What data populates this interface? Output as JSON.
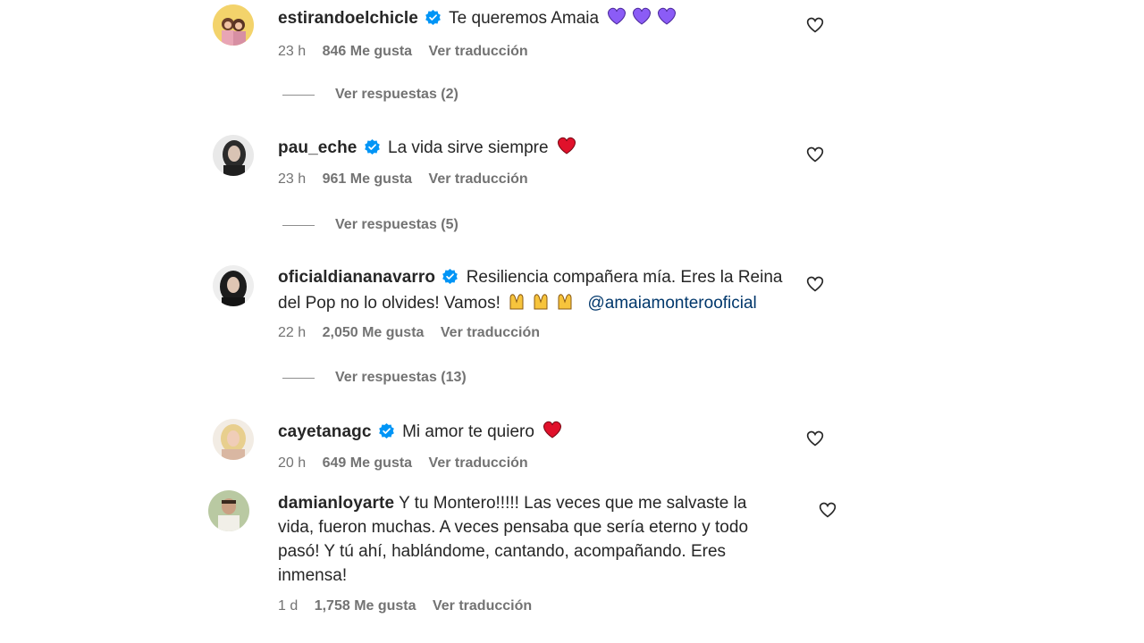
{
  "comments": [
    {
      "username": "estirandoelchicle",
      "verified": true,
      "text": "Te queremos Amaia",
      "emoji": "purple-heart x3",
      "time": "23 h",
      "likes": "846 Me gusta",
      "translate": "Ver traducción",
      "replies": "Ver respuestas (2)"
    },
    {
      "username": "pau_eche",
      "verified": true,
      "text": "La vida sirve siempre",
      "emoji": "red-heart",
      "time": "23 h",
      "likes": "961 Me gusta",
      "translate": "Ver traducción",
      "replies": "Ver respuestas (5)"
    },
    {
      "username": "oficialdiananavarro",
      "verified": true,
      "text_line1": "Resiliencia compañera mía. Eres la Reina",
      "text_line2": "del Pop no lo olvides! Vamos!",
      "mention": "@amaiamonterooficial",
      "emoji": "raising-hands x3",
      "time": "22 h",
      "likes": "2,050 Me gusta",
      "translate": "Ver traducción",
      "replies": "Ver respuestas (13)"
    },
    {
      "username": "cayetanagc",
      "verified": true,
      "text": "Mi amor te quiero",
      "emoji": "red-heart",
      "time": "20 h",
      "likes": "649 Me gusta",
      "translate": "Ver traducción"
    },
    {
      "username": "damianloyarte",
      "verified": false,
      "text_line1": "Y tu Montero!!!!! Las veces que me salvaste la",
      "text_line2": "vida, fueron muchas. A veces pensaba que sería eterno y todo",
      "text_line3": "pasó! Y tú ahí, hablándome, cantando, acompañando. Eres",
      "text_line4": "inmensa!",
      "time": "1 d",
      "likes": "1,758 Me gusta",
      "translate": "Ver traducción"
    }
  ],
  "colors": {
    "text": "#262626",
    "meta": "#737373",
    "verified": "#0095f6",
    "mention": "#00376b",
    "red_heart": "#e0112b",
    "purple_heart": "#8b5cf6"
  }
}
